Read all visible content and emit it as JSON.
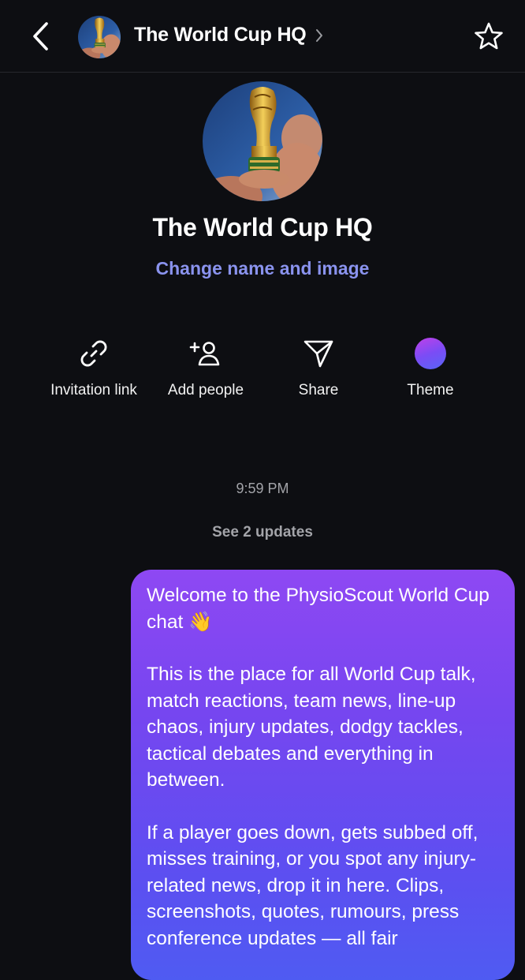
{
  "header": {
    "back_icon": "chevron-left-icon",
    "title": "The World Cup HQ",
    "chevron_icon": "chevron-right-icon",
    "star_icon": "star-icon"
  },
  "group": {
    "name": "The World Cup HQ",
    "change_link": "Change name and image"
  },
  "actions": [
    {
      "label": "Invitation link",
      "icon": "link-icon"
    },
    {
      "label": "Add people",
      "icon": "add-person-icon"
    },
    {
      "label": "Share",
      "icon": "send-icon"
    },
    {
      "label": "Theme",
      "icon": "theme-circle-icon"
    }
  ],
  "chat": {
    "timestamp": "9:59 PM",
    "updates_link": "See 2 updates",
    "message": {
      "paragraphs": [
        "Welcome to the PhysioScout World Cup chat 👋",
        "This is the place for all World Cup talk, match reactions, team news, line-up chaos, injury updates, dodgy tackles, tactical debates and everything in between.",
        "If a player goes down, gets subbed off, misses training, or you spot any injury-related news, drop it in here. Clips, screenshots, quotes, rumours, press conference updates — all fair"
      ]
    }
  },
  "colors": {
    "background": "#0d0e12",
    "link": "#8a93ee",
    "muted_text": "#a3a4a9",
    "bubble_top": "#8e48f3",
    "bubble_bottom": "#4f5bf2"
  }
}
